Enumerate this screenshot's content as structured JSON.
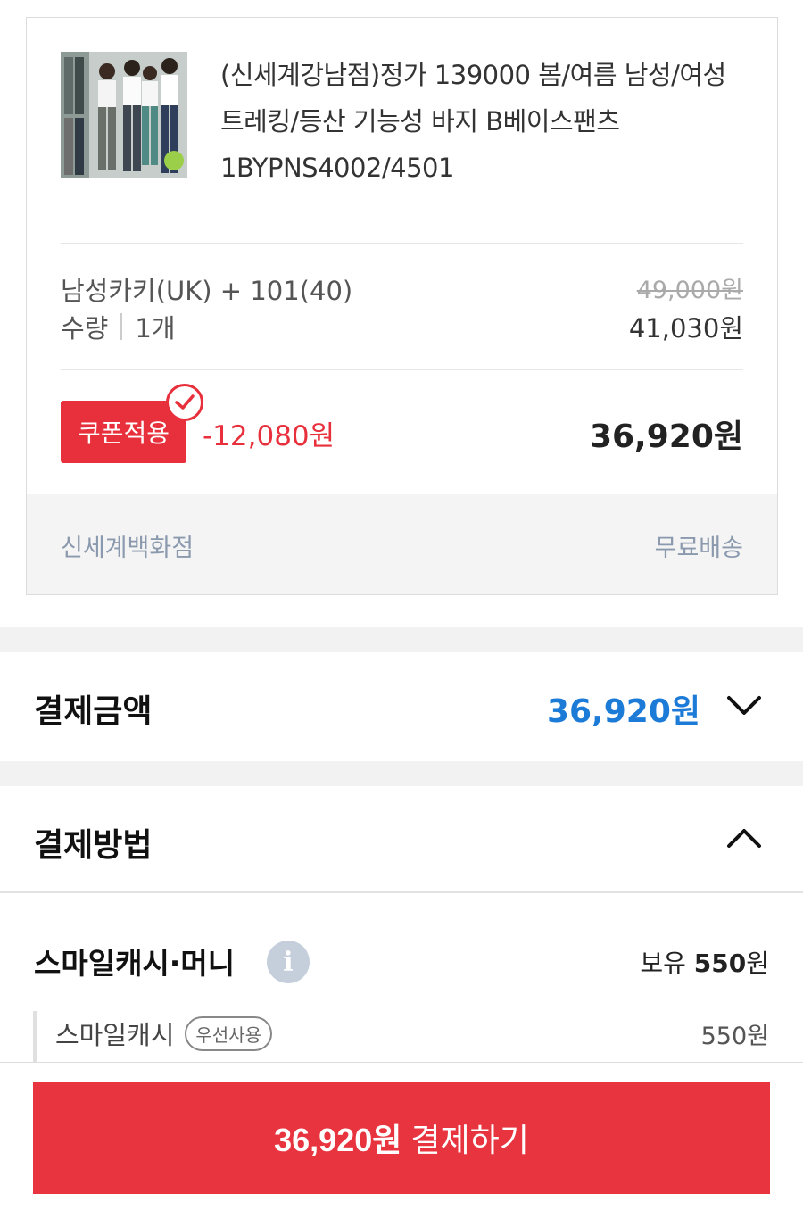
{
  "order_item": {
    "title": "(신세계강남점)정가 139000 봄/여름 남성/여성 트레킹/등산 기능성 바지 B베이스팬츠 1BYPNS4002/4501",
    "option": "남성카키(UK) + 101(40)",
    "quantity_label": "수량",
    "quantity_value": "1개",
    "original_price": "49,000원",
    "sale_price": "41,030원",
    "coupon_label": "쿠폰적용",
    "coupon_discount": "-12,080원",
    "final_price": "36,920원",
    "seller": "신세계백화점",
    "shipping": "무료배송"
  },
  "payment_amount": {
    "label": "결제금액",
    "value": "36,920원"
  },
  "payment_method": {
    "label": "결제방법",
    "smile_title": "스마일캐시·머니",
    "hold_prefix": "보유",
    "hold_amount": "550",
    "hold_unit": "원",
    "sub_label": "스마일캐시",
    "sub_badge": "우선사용",
    "sub_value": "550원"
  },
  "pay_button": {
    "amount": "36,920원",
    "label": "결제하기"
  },
  "colors": {
    "accent_red": "#e8303c",
    "accent_blue": "#1d7bd8"
  }
}
